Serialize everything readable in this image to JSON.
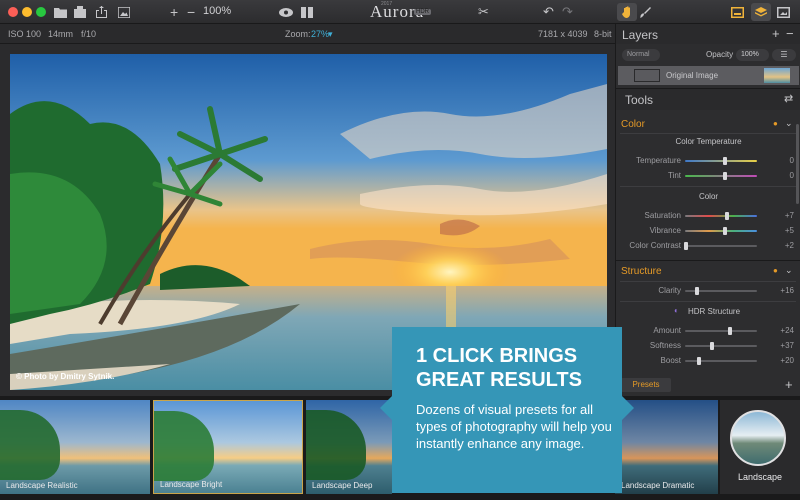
{
  "titlebar": {
    "app_name": "Aurora",
    "app_badge": "HDR",
    "app_year": "2017",
    "zoom_level": "100%",
    "icons": [
      "close-light",
      "minimize-light",
      "maximize-light",
      "folder-icon",
      "export-icon",
      "share-icon",
      "image-icon",
      "zoom-in-icon",
      "zoom-out-icon",
      "preview-eye-icon",
      "compare-split-icon",
      "crop-tools-icon",
      "undo-icon",
      "redo-icon",
      "hand-brush-icon",
      "brush-icon",
      "layout-single-icon",
      "layers-icon",
      "fullscreen-icon"
    ]
  },
  "infobar": {
    "iso": "ISO 100",
    "focal": "14mm",
    "aperture": "f/10",
    "zoom_label": "Zoom:",
    "zoom_value": "27%",
    "dimensions": "7181 x 4039",
    "bit_depth": "8-bit"
  },
  "photo": {
    "credit": "© Photo by Dmitry Sytnik."
  },
  "layers": {
    "title": "Layers",
    "blend_mode": "Normal",
    "opacity_label": "Opacity",
    "opacity_value": "100%",
    "layer_name": "Original Image"
  },
  "tools": {
    "title": "Tools",
    "color_section": "Color",
    "color_temp_group": "Color Temperature",
    "color_group": "Color",
    "structure_section": "Structure",
    "hdr_structure_group": "HDR Structure",
    "rows": [
      {
        "label": "Temperature",
        "value": "0",
        "level": 0.55
      },
      {
        "label": "Tint",
        "value": "0",
        "level": 0.55
      },
      {
        "label": "Saturation",
        "value": "+7",
        "level": 0.58
      },
      {
        "label": "Vibrance",
        "value": "+5",
        "level": 0.55
      },
      {
        "label": "Color Contrast",
        "value": "+2",
        "level": 0.01
      },
      {
        "label": "Clarity",
        "value": "+16",
        "level": 0.16
      },
      {
        "label": "Amount",
        "value": "+24",
        "level": 0.62
      },
      {
        "label": "Softness",
        "value": "+37",
        "level": 0.37
      },
      {
        "label": "Boost",
        "value": "+20",
        "level": 0.2
      }
    ]
  },
  "presets": {
    "tab_label": "Presets",
    "items": [
      "Landscape Realistic",
      "Landscape Bright",
      "Landscape Deep",
      "Landscape Dramatic"
    ],
    "category": "Landscape"
  },
  "promo": {
    "headline_line1": "1 CLICK BRINGS",
    "headline_line2": "GREAT RESULTS",
    "body": "Dozens of  visual presets for all types of photography will help you instantly enhance any image."
  },
  "colors": {
    "accent_orange": "#e59a27",
    "accent_blue": "#3fb0d8",
    "promo_teal": "#3596b7"
  }
}
